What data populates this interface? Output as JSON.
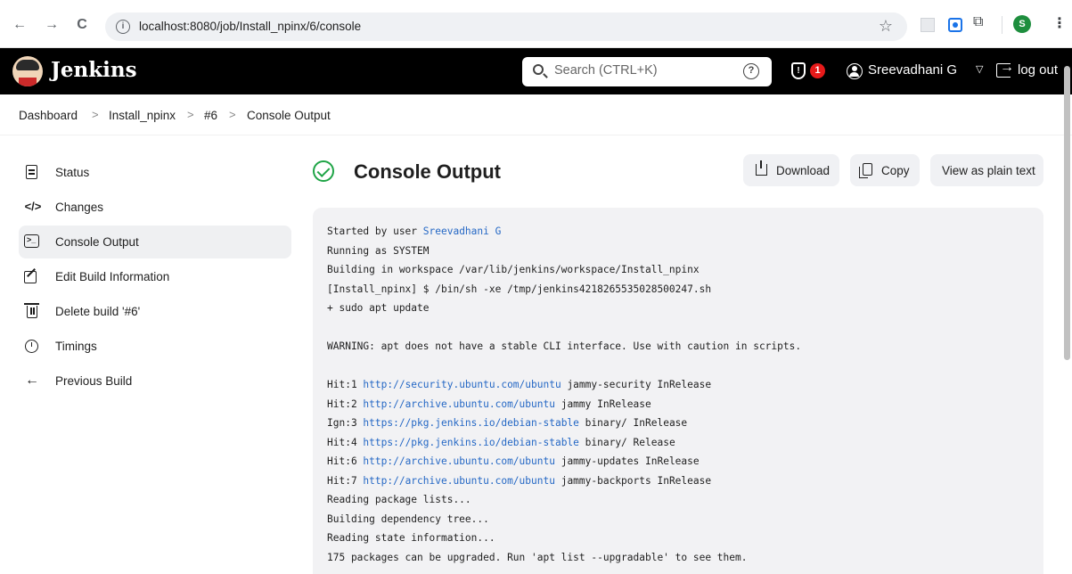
{
  "browser": {
    "url": "localhost:8080/job/Install_npinx/6/console",
    "back": "←",
    "forward": "→",
    "reload": "C",
    "profile_initial": "S"
  },
  "header": {
    "brand": "Jenkins",
    "search_placeholder": "Search (CTRL+K)",
    "help": "?",
    "security_badge_count": "1",
    "user": "Sreevadhani G",
    "logout": "log out"
  },
  "breadcrumb": [
    "Dashboard",
    "Install_npinx",
    "#6",
    "Console Output"
  ],
  "sidebar": {
    "items": [
      {
        "label": "Status",
        "icon": "status-icon",
        "active": false
      },
      {
        "label": "Changes",
        "icon": "code-icon",
        "active": false
      },
      {
        "label": "Console Output",
        "icon": "terminal-icon",
        "active": true
      },
      {
        "label": "Edit Build Information",
        "icon": "edit-icon",
        "active": false
      },
      {
        "label": "Delete build '#6'",
        "icon": "trash-icon",
        "active": false
      },
      {
        "label": "Timings",
        "icon": "timer-icon",
        "active": false
      },
      {
        "label": "Previous Build",
        "icon": "arrow-left-icon",
        "active": false
      }
    ]
  },
  "main": {
    "title": "Console Output",
    "status_color": "#1ea446",
    "buttons": {
      "download": "Download",
      "copy": "Copy",
      "plain": "View as plain text"
    }
  },
  "console": {
    "lines": [
      {
        "pre": "Started by user ",
        "link": "Sreevadhani G",
        "post": ""
      },
      {
        "pre": "Running as SYSTEM",
        "link": "",
        "post": ""
      },
      {
        "pre": "Building in workspace /var/lib/jenkins/workspace/Install_npinx",
        "link": "",
        "post": ""
      },
      {
        "pre": "[Install_npinx] $ /bin/sh -xe /tmp/jenkins4218265535028500247.sh",
        "link": "",
        "post": ""
      },
      {
        "pre": "+ sudo apt update",
        "link": "",
        "post": ""
      },
      {
        "pre": "",
        "link": "",
        "post": ""
      },
      {
        "pre": "WARNING: apt does not have a stable CLI interface. Use with caution in scripts.",
        "link": "",
        "post": ""
      },
      {
        "pre": "",
        "link": "",
        "post": ""
      },
      {
        "pre": "Hit:1 ",
        "link": "http://security.ubuntu.com/ubuntu",
        "post": " jammy-security InRelease"
      },
      {
        "pre": "Hit:2 ",
        "link": "http://archive.ubuntu.com/ubuntu",
        "post": " jammy InRelease"
      },
      {
        "pre": "Ign:3 ",
        "link": "https://pkg.jenkins.io/debian-stable",
        "post": " binary/ InRelease"
      },
      {
        "pre": "Hit:4 ",
        "link": "https://pkg.jenkins.io/debian-stable",
        "post": " binary/ Release"
      },
      {
        "pre": "Hit:6 ",
        "link": "http://archive.ubuntu.com/ubuntu",
        "post": " jammy-updates InRelease"
      },
      {
        "pre": "Hit:7 ",
        "link": "http://archive.ubuntu.com/ubuntu",
        "post": " jammy-backports InRelease"
      },
      {
        "pre": "Reading package lists...",
        "link": "",
        "post": ""
      },
      {
        "pre": "Building dependency tree...",
        "link": "",
        "post": ""
      },
      {
        "pre": "Reading state information...",
        "link": "",
        "post": ""
      },
      {
        "pre": "175 packages can be upgraded. Run 'apt list --upgradable' to see them.",
        "link": "",
        "post": ""
      }
    ]
  }
}
